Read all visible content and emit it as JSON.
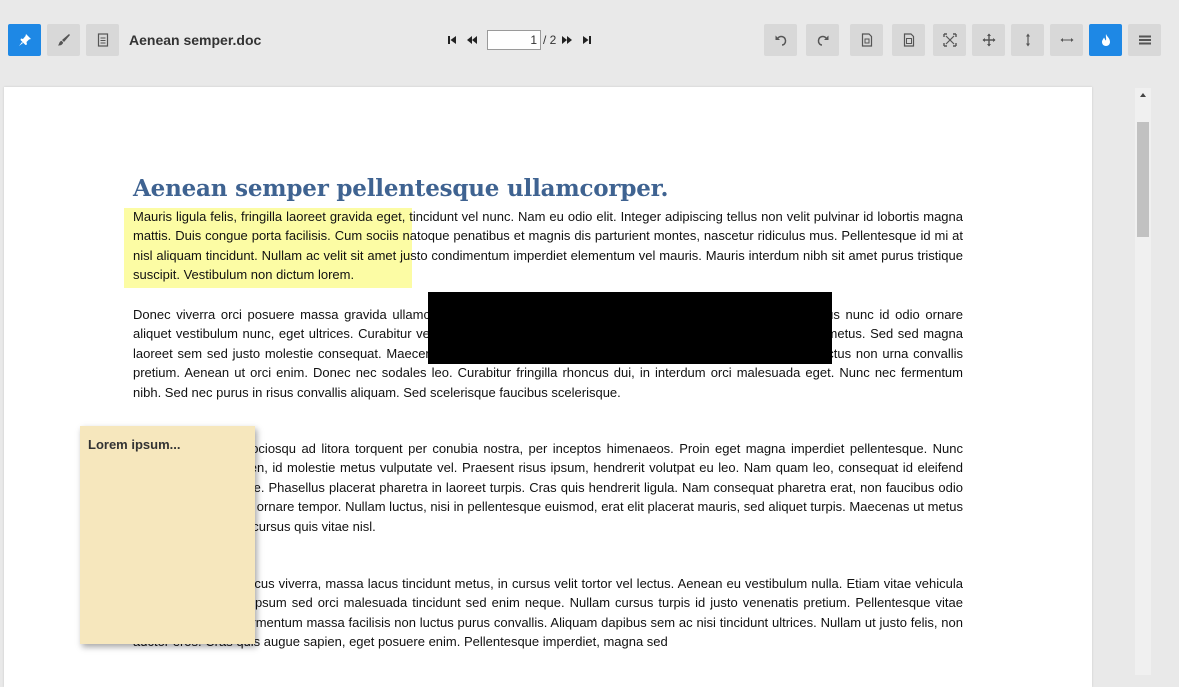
{
  "toolbar": {
    "left_buttons": [
      {
        "icon": "pin-icon",
        "active": true
      },
      {
        "icon": "brush-icon",
        "active": false
      },
      {
        "icon": "document-icon",
        "active": false
      }
    ],
    "document_title": "Aenean semper.doc",
    "pager": {
      "current_page": "1",
      "total": "/ 2"
    },
    "right_buttons": [
      {
        "icon": "undo-icon"
      },
      {
        "icon": "redo-icon"
      },
      {
        "icon": "fit-page-icon"
      },
      {
        "icon": "page-icon"
      },
      {
        "icon": "fit-width-icon"
      },
      {
        "icon": "move-icon"
      },
      {
        "icon": "vertical-resize-icon"
      },
      {
        "icon": "horizontal-resize-icon"
      },
      {
        "icon": "fire-icon"
      },
      {
        "icon": "menu-icon"
      }
    ],
    "accent_color": "#1e88e5"
  },
  "document": {
    "heading": "Aenean semper pellentesque ullamcorper.",
    "paragraphs": [
      "Mauris ligula felis, fringilla laoreet gravida eget, tincidunt vel nunc. Nam eu odio elit. Integer adipiscing tellus non velit pulvinar id lobortis magna mattis. Duis congue porta facilisis. Cum sociis natoque penatibus et magnis dis parturient montes, nascetur ridiculus mus. Pellentesque id mi at nisl aliquam tincidunt. Nullam ac velit sit amet justo condimentum imperdiet elementum vel mauris. Mauris interdum nibh sit amet purus tristique suscipit. Vestibulum non dictum lorem.",
      "Donec viverra orci posuere massa gravida ullamcorper. Nam ut risus quis metus faucibus pulvinar nulla. Fusce varius nunc id odio ornare aliquet vestibulum nunc, eget ultrices. Curabitur vehicula, augue magna pharetra metus, quis gravida urna lectus quis metus. Sed sed magna laoreet sem sed justo molestie consequat. Maecenas fermentum vehicula enim quis lacinia. Nulla facilisi. Donec eu lectus non urna convallis pretium. Aenean ut orci enim. Donec nec sodales leo. Curabitur fringilla rhoncus dui, in interdum orci malesuada eget. Nunc nec fermentum nibh. Sed nec purus in risus convallis aliquam. Sed scelerisque faucibus scelerisque.",
      "Class aptent taciti sociosqu ad litora torquent per conubia nostra, per inceptos himenaeos. Proin eget magna imperdiet pellentesque. Nunc dictum volutpat sapien, id molestie metus vulputate vel. Praesent risus ipsum, hendrerit volutpat eu leo. Nam quam leo, consequat id eleifend ac, hendrerit et augue. Phasellus placerat pharetra in laoreet turpis. Cras quis hendrerit ligula. Nam consequat pharetra erat, non faucibus odio posuere dui id ipsum ornare tempor. Nullam luctus, nisi in pellentesque euismod, erat elit placerat mauris, sed aliquet turpis. Maecenas ut metus tempus nunc rutrum cursus quis vitae nisl.",
      "Curabitur, nisl a rhoncus viverra, massa lacus tincidunt metus, in cursus velit tortor vel lectus. Aenean eu vestibulum nulla. Etiam vitae vehicula quam. Nullam vitae ipsum sed orci malesuada tincidunt sed enim neque. Nullam cursus turpis id justo venenatis pretium. Pellentesque vitae arcu magna. Cras fermentum massa facilisis non luctus purus convallis. Aliquam dapibus sem ac nisi tincidunt ultrices. Nullam ut justo felis, non auctor eros. Cras quis augue sapien, eget posuere enim. Pellentesque imperdiet, magna sed"
    ],
    "sticky_note": "Lorem ipsum...",
    "highlight_color": "#fafa5a",
    "redaction_color": "#000000",
    "heading_color": "#3f6391"
  }
}
